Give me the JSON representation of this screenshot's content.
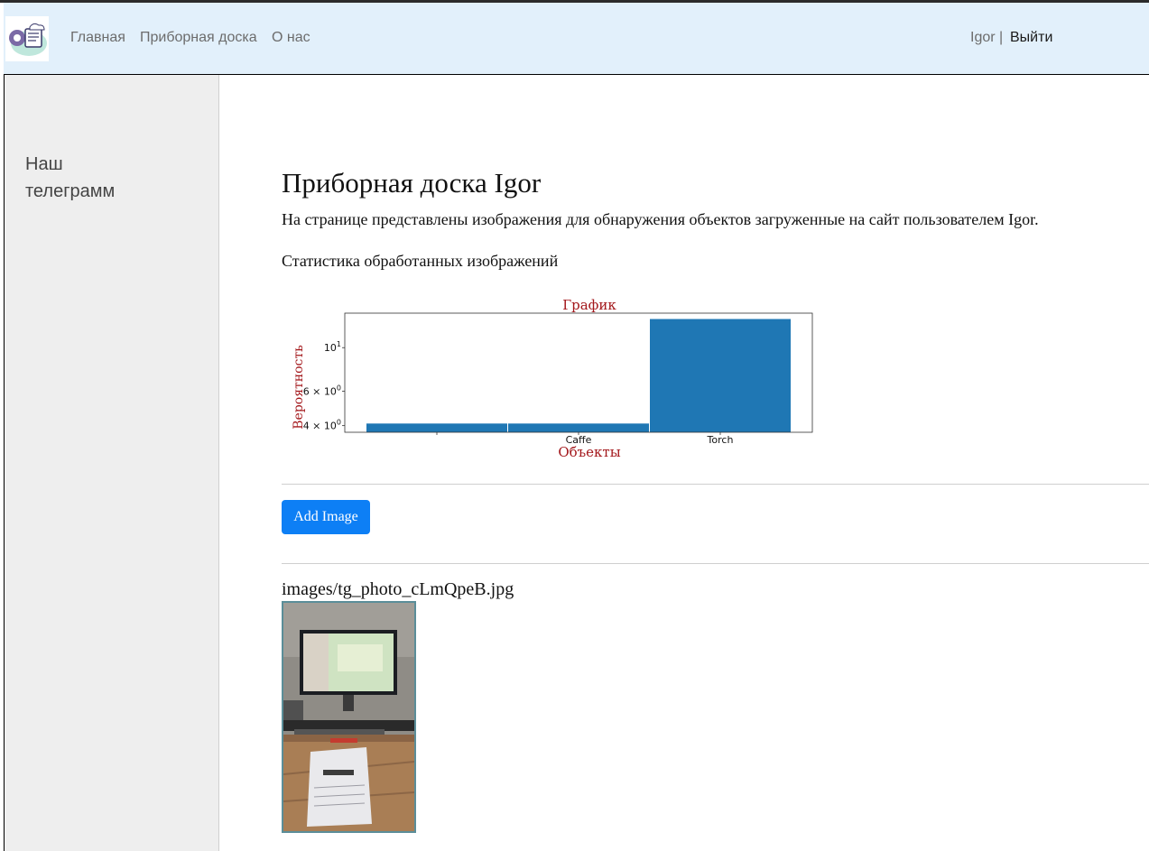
{
  "navbar": {
    "links": [
      "Главная",
      "Приборная доска",
      "О нас"
    ],
    "user": "Igor |",
    "logout": "Выйти"
  },
  "sidebar": {
    "telegram_link": "Наш телеграмм"
  },
  "main": {
    "title": "Приборная доска Igor",
    "description": "На странице представлены изображения для обнаружения объектов загруженные на сайт пользователем Igor.",
    "stats_heading": "Статистика обработанных изображений",
    "add_button": "Add Image",
    "image_caption": "images/tg_photo_cLmQpeB.jpg"
  },
  "chart_data": {
    "type": "bar",
    "title": "График",
    "xlabel": "Объекты",
    "ylabel": "Вероятность",
    "yscale": "log",
    "categories": [
      "",
      "Caffe",
      "Torch"
    ],
    "values": [
      4.1,
      4.1,
      14
    ],
    "ylim": [
      3.7,
      15
    ],
    "yticks": [
      {
        "value": 10,
        "base": "10",
        "exp": "1"
      },
      {
        "value": 6,
        "base": "6 × 10",
        "exp": "0"
      },
      {
        "value": 4,
        "base": "4 × 10",
        "exp": "0"
      }
    ],
    "bar_color": "#1f77b4",
    "label_color": "#a3171b"
  }
}
